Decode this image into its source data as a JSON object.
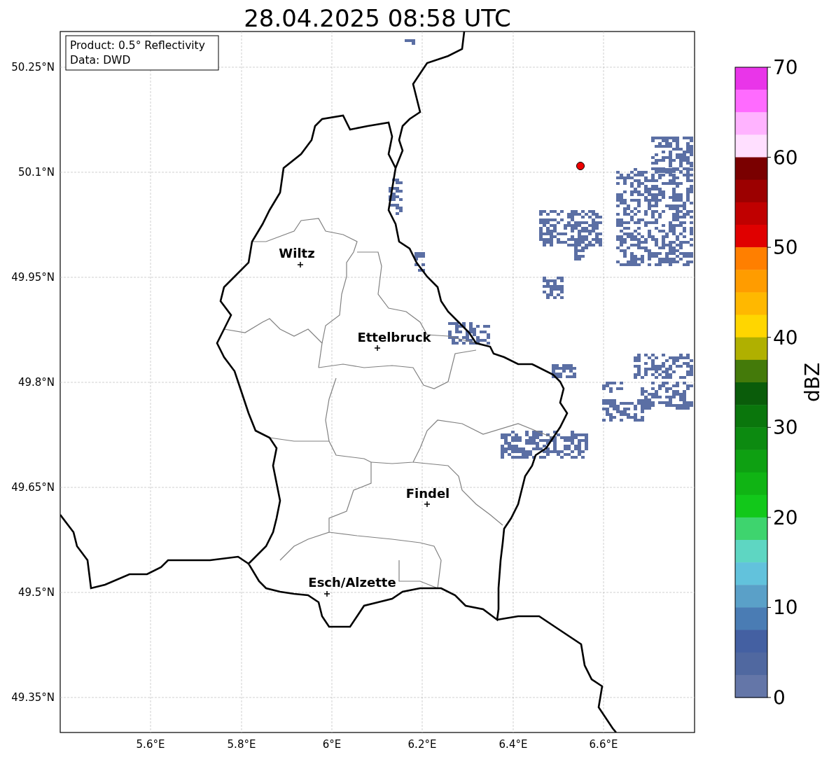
{
  "title": "28.04.2025 08:58 UTC",
  "info_box": [
    "Product: 0.5° Reflectivity",
    "Data: DWD"
  ],
  "map": {
    "x_ticks": [
      "5.6°E",
      "5.8°E",
      "6°E",
      "6.2°E",
      "6.4°E",
      "6.6°E"
    ],
    "y_ticks": [
      "50.25°N",
      "50.1°N",
      "49.95°N",
      "49.8°N",
      "49.65°N",
      "49.5°N",
      "49.35°N"
    ],
    "cities": [
      {
        "name": "Wiltz"
      },
      {
        "name": "Ettelbruck"
      },
      {
        "name": "Findel"
      },
      {
        "name": "Esch/Alzette"
      }
    ]
  },
  "colorbar": {
    "label": "dBZ",
    "ticks": [
      "70",
      "60",
      "50",
      "40",
      "30",
      "20",
      "10",
      "0"
    ],
    "segments": [
      {
        "color": "#e935e9"
      },
      {
        "color": "#ff6bff"
      },
      {
        "color": "#ffb3ff"
      },
      {
        "color": "#ffdfff"
      },
      {
        "color": "#7a0000"
      },
      {
        "color": "#9c0000"
      },
      {
        "color": "#c00000"
      },
      {
        "color": "#e00000"
      },
      {
        "color": "#ff7f00"
      },
      {
        "color": "#ff9c00"
      },
      {
        "color": "#ffb800"
      },
      {
        "color": "#ffd600"
      },
      {
        "color": "#b0b000"
      },
      {
        "color": "#447a0a"
      },
      {
        "color": "#0a5c0a"
      },
      {
        "color": "#0a760c"
      },
      {
        "color": "#0c8a10"
      },
      {
        "color": "#0ea012"
      },
      {
        "color": "#10b414"
      },
      {
        "color": "#12c81a"
      },
      {
        "color": "#3ed46e"
      },
      {
        "color": "#5ed6c2"
      },
      {
        "color": "#62c2dc"
      },
      {
        "color": "#5aa0c8"
      },
      {
        "color": "#4a7cb4"
      },
      {
        "color": "#4460a2"
      },
      {
        "color": "#5068a0"
      },
      {
        "color": "#6476a8"
      }
    ]
  }
}
